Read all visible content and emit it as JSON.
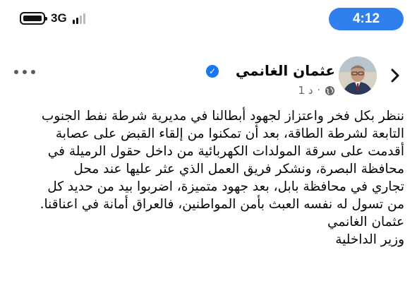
{
  "status_bar": {
    "network": "3G",
    "time": "4:12"
  },
  "post": {
    "author": "عثمان الغانمي",
    "time_ago": "1 د",
    "body_lines": [
      "ننظر بكل فخر واعتزاز لجهود أبطالنا في مديرية شرطة نفط الجنوب",
      "التابعة لشرطة الطاقة، بعد أن تمكنوا من إلقاء القبض على عصابة",
      "أقدمت على سرقة المولدات الكهربائية من داخل حقول الرميلة في",
      "محافظة البصرة، ونشكر فريق العمل الذي عثر عليها عند محل",
      "تجاري في محافظة بابل، بعد جهود متميزة، اضربوا بيد من حديد كل",
      "من تسول له نفسه العبث بأمن المواطنين، فالعراق أمانة في اعناقنا.",
      "عثمان الغانمي",
      "وزير الداخلية"
    ]
  },
  "icons": {
    "battery": "battery-icon",
    "signal": "signal-icon",
    "more": "more-horizontal-icon",
    "verified": "verified-badge-icon",
    "privacy": "globe-icon",
    "back": "chevron-right-icon"
  },
  "colors": {
    "time_pill": "#2f80ed",
    "verified": "#1877f2",
    "meta_text": "#65676b"
  }
}
